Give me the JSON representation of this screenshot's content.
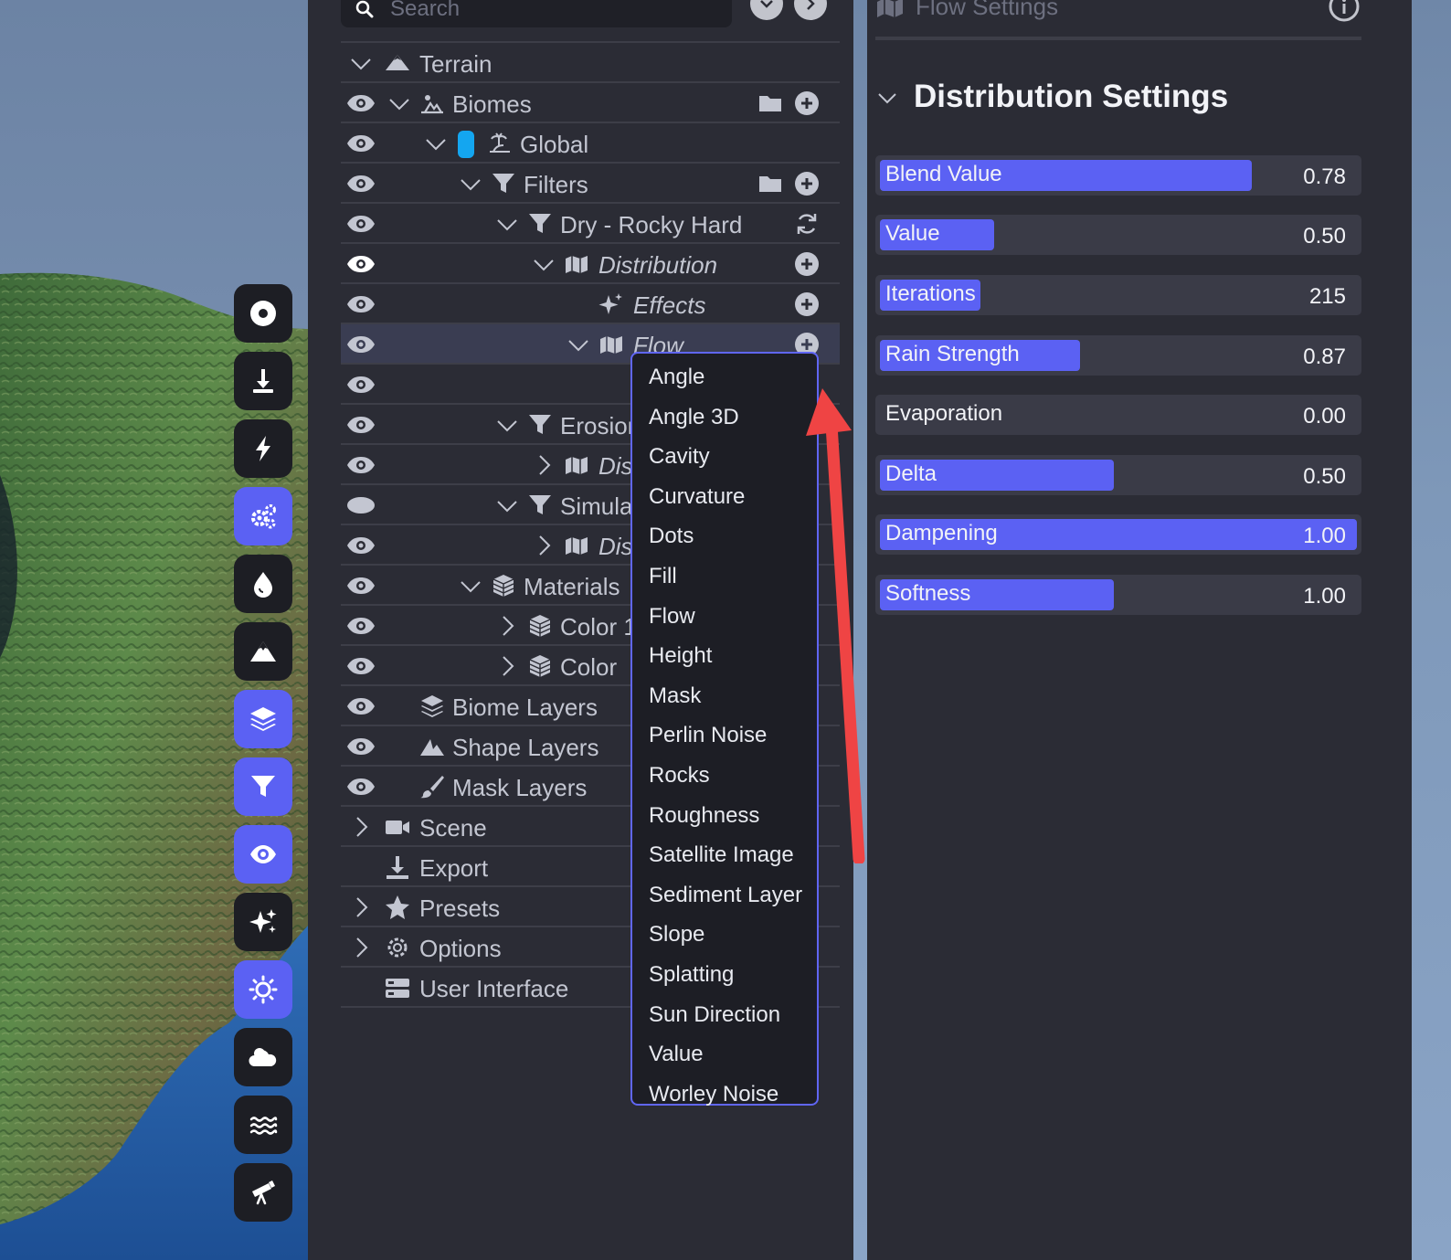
{
  "search": {
    "placeholder": "Search"
  },
  "tree": [
    {
      "label": "Terrain"
    },
    {
      "label": "Biomes"
    },
    {
      "label": "Global"
    },
    {
      "label": "Filters"
    },
    {
      "label": "Dry - Rocky Hard"
    },
    {
      "label": "Distribution"
    },
    {
      "label": "Effects"
    },
    {
      "label": "Flow"
    },
    {
      "label": ""
    },
    {
      "label": "Erosion"
    },
    {
      "label": "Dist"
    },
    {
      "label": "Simula"
    },
    {
      "label": "Dist"
    },
    {
      "label": "Materials"
    },
    {
      "label": "Color 1"
    },
    {
      "label": "Color"
    },
    {
      "label": "Biome Layers"
    },
    {
      "label": "Shape Layers"
    },
    {
      "label": "Mask Layers"
    },
    {
      "label": "Scene"
    },
    {
      "label": "Export"
    },
    {
      "label": "Presets"
    },
    {
      "label": "Options"
    },
    {
      "label": "User Interface"
    }
  ],
  "dropdown": {
    "items": [
      "Angle",
      "Angle 3D",
      "Cavity",
      "Curvature",
      "Dots",
      "Fill",
      "Flow",
      "Height",
      "Mask",
      "Perlin Noise",
      "Rocks",
      "Roughness",
      "Satellite Image",
      "Sediment Layer",
      "Slope",
      "Splatting",
      "Sun Direction",
      "Value",
      "Worley Noise"
    ]
  },
  "settings": {
    "header_title": "Flow Settings",
    "section_title": "Distribution Settings",
    "sliders": [
      {
        "name": "Blend Value",
        "value": "0.78",
        "fill": 0.78
      },
      {
        "name": "Value",
        "value": "0.50",
        "fill": 0.24
      },
      {
        "name": "Iterations",
        "value": "215",
        "fill": 0.21
      },
      {
        "name": "Rain Strength",
        "value": "0.87",
        "fill": 0.42
      },
      {
        "name": "Evaporation",
        "value": "0.00",
        "fill": 0.0
      },
      {
        "name": "Delta",
        "value": "0.50",
        "fill": 0.49
      },
      {
        "name": "Dampening",
        "value": "1.00",
        "fill": 1.0
      },
      {
        "name": "Softness",
        "value": "1.00",
        "fill": 0.49
      }
    ]
  },
  "colors": {
    "accent": "#5b61f3",
    "panel": "#2b2c35",
    "arrow": "#ef4444",
    "chip": "#14a6f0"
  },
  "toolbar_icons": [
    "record-icon",
    "download-icon",
    "lightning-icon",
    "gears-icon",
    "water-drop-icon",
    "mountain-icon",
    "layers-icon",
    "filter-icon",
    "eye-icon",
    "sparkles-icon",
    "sun-icon",
    "cloud-icon",
    "waves-icon",
    "telescope-icon"
  ]
}
